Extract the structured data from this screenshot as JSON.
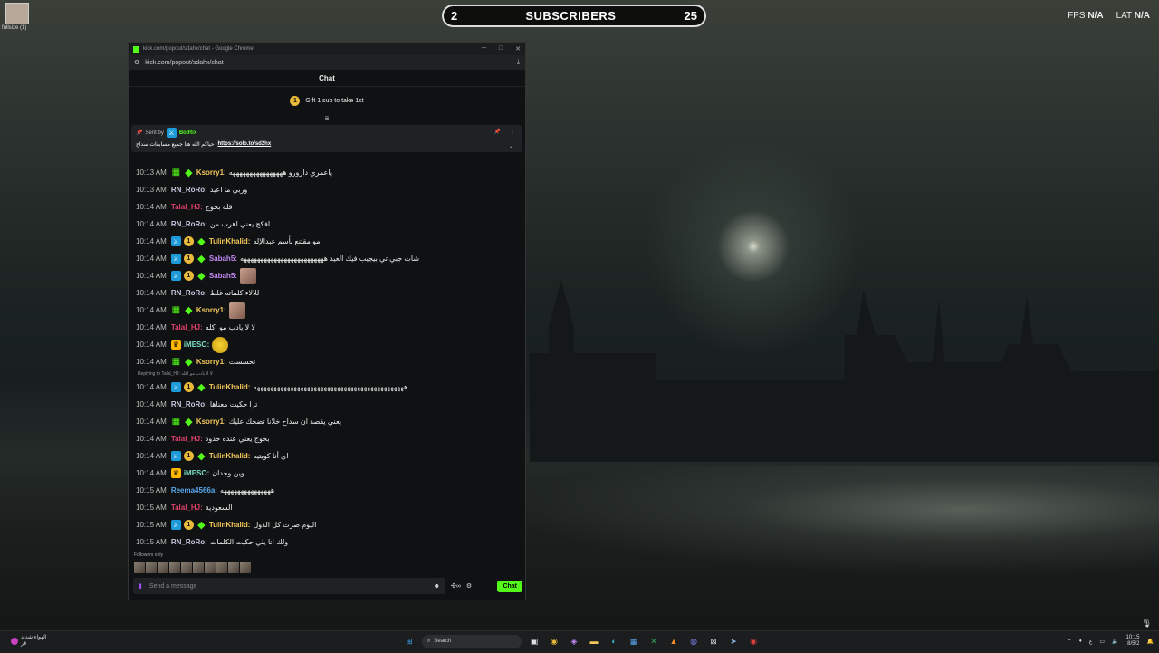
{
  "desktop": {
    "icon_label": "fullsize (1)"
  },
  "subscribers": {
    "left": "2",
    "title": "SUBSCRIBERS",
    "right": "25"
  },
  "stats": {
    "fps_label": "FPS",
    "fps_value": "N/A",
    "lat_label": "LAT",
    "lat_value": "N/A"
  },
  "browser": {
    "title": "kick.com/popout/sdahx/chat - Google Chrome",
    "url": "kick.com/popout/sdahx/chat"
  },
  "chat": {
    "header": "Chat",
    "gift_count": "1",
    "gift_text": "Gift 1 sub to take 1st",
    "pinned": {
      "sent_by": "Sent by",
      "bot": "BotRix",
      "text": "حياكم الله هنا جميع مسابقات سداح",
      "link": "https://solo.to/sd2hx"
    },
    "reply_hint": "Replying to Talal_HJ: لا لا يادب مو اكله",
    "followers_only": "Followers only",
    "input_placeholder": "Send a message",
    "chat_button": "Chat",
    "messages": [
      {
        "time": "10:13 AM",
        "user": "Ksorry1:",
        "color": "#f5c85c",
        "badges": [
          "og",
          "dia"
        ],
        "text": "ياعمري دارورو ههههههههههههههههه"
      },
      {
        "time": "10:13 AM",
        "user": "RN_RoRo:",
        "color": "#c7c7e0",
        "badges": [],
        "text": "وربي ما اعبد"
      },
      {
        "time": "10:14 AM",
        "user": "Talal_HJ:",
        "color": "#e0406a",
        "badges": [],
        "text": "قله بخوج"
      },
      {
        "time": "10:14 AM",
        "user": "RN_RoRo:",
        "color": "#c7c7e0",
        "badges": [],
        "text": "افكج يعني اهرب من"
      },
      {
        "time": "10:14 AM",
        "user": "TulinKhalid:",
        "color": "#f5c85c",
        "badges": [
          "mod",
          "sub",
          "dia"
        ],
        "text": "مو مقتنع بأسم عبدالإله"
      },
      {
        "time": "10:14 AM",
        "user": "Sabah5:",
        "color": "#c58af5",
        "badges": [
          "mod",
          "sub",
          "dia"
        ],
        "text": "شات جبي تي بيجيب فيك العيد هههههههههههههههههههههههههه"
      },
      {
        "time": "10:14 AM",
        "user": "Sabah5:",
        "color": "#c58af5",
        "badges": [
          "mod",
          "sub",
          "dia"
        ],
        "text": "",
        "emote": "face"
      },
      {
        "time": "10:14 AM",
        "user": "RN_RoRo:",
        "color": "#c7c7e0",
        "badges": [],
        "text": "للالاء كلماته غلط"
      },
      {
        "time": "10:14 AM",
        "user": "Ksorry1:",
        "color": "#f5c85c",
        "badges": [
          "og",
          "dia"
        ],
        "text": "",
        "emote": "face"
      },
      {
        "time": "10:14 AM",
        "user": "Talal_HJ:",
        "color": "#e0406a",
        "badges": [],
        "text": "لا لا يادب مو اكله"
      },
      {
        "time": "10:14 AM",
        "user": "iMESO:",
        "color": "#7de0c0",
        "badges": [
          "vip"
        ],
        "text": "",
        "emote": "round"
      },
      {
        "time": "10:14 AM",
        "user": "Ksorry1:",
        "color": "#f5c85c",
        "badges": [
          "og",
          "dia"
        ],
        "text": "تحسست"
      },
      {
        "time": "10:14 AM",
        "user": "TulinKhalid:",
        "color": "#f5c85c",
        "badges": [
          "mod",
          "sub",
          "dia"
        ],
        "text": "هههههههههههههههههههههههههههههههههههههههههههههه",
        "reply": true
      },
      {
        "time": "10:14 AM",
        "user": "RN_RoRo:",
        "color": "#c7c7e0",
        "badges": [],
        "text": "ترا حكيت معناها"
      },
      {
        "time": "10:14 AM",
        "user": "Ksorry1:",
        "color": "#f5c85c",
        "badges": [
          "og",
          "dia"
        ],
        "text": "يعني يقصد ان سداح خلانا تضحك عليك"
      },
      {
        "time": "10:14 AM",
        "user": "Talal_HJ:",
        "color": "#e0406a",
        "badges": [],
        "text": "بخوج يعني عنده خدود"
      },
      {
        "time": "10:14 AM",
        "user": "TulinKhalid:",
        "color": "#f5c85c",
        "badges": [
          "mod",
          "sub",
          "dia"
        ],
        "text": "اي أنا كويتيه"
      },
      {
        "time": "10:14 AM",
        "user": "iMESO:",
        "color": "#7de0c0",
        "badges": [
          "vip"
        ],
        "text": "وين وجدان"
      },
      {
        "time": "10:15 AM",
        "user": "Reema4566a:",
        "color": "#5aa9f0",
        "badges": [],
        "text": "هههههههههههههههه"
      },
      {
        "time": "10:15 AM",
        "user": "Talal_HJ:",
        "color": "#e0406a",
        "badges": [],
        "text": "السعودية"
      },
      {
        "time": "10:15 AM",
        "user": "TulinKhalid:",
        "color": "#f5c85c",
        "badges": [
          "mod",
          "sub",
          "dia"
        ],
        "text": "اليوم صرت كل الدول"
      },
      {
        "time": "10:15 AM",
        "user": "RN_RoRo:",
        "color": "#c7c7e0",
        "badges": [],
        "text": "ولك انا يلي حكيت الكلمات"
      }
    ]
  },
  "taskbar": {
    "weather": "الهواء شديد",
    "weather_sub": "قر",
    "search": "Search",
    "lang": "ع",
    "time": "10:15",
    "date": "8/5/2"
  }
}
